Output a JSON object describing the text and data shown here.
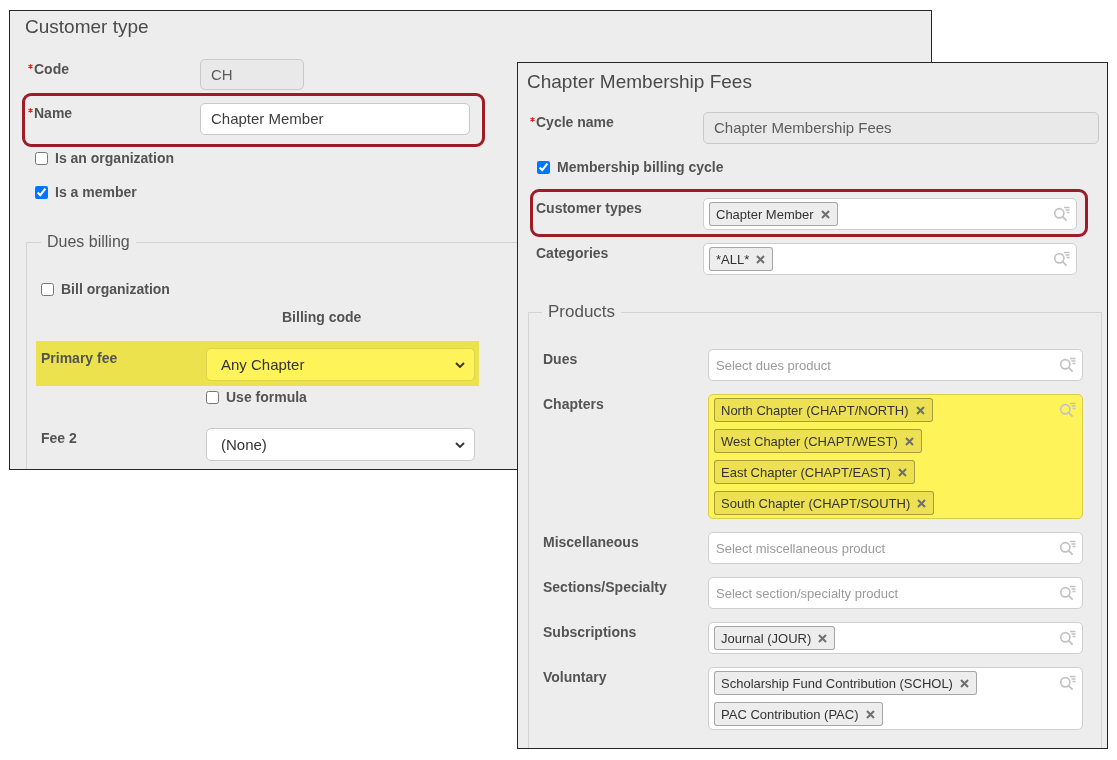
{
  "customer_type_window": {
    "title": "Customer type",
    "fields": [
      {
        "label": "Code",
        "required": true,
        "value": "CH",
        "disabled": true,
        "outlined": false
      },
      {
        "label": "Name",
        "required": true,
        "value": "Chapter Member",
        "disabled": false,
        "outlined": true
      }
    ],
    "checkboxes": [
      {
        "label": "Is an organization",
        "checked": false
      },
      {
        "label": "Is a member",
        "checked": true
      }
    ],
    "dues_billing": {
      "legend": "Dues billing",
      "bill_organization": {
        "label": "Bill organization",
        "checked": false
      },
      "column_heading": "Billing code",
      "fees": [
        {
          "label": "Primary fee",
          "value": "Any Chapter",
          "highlighted": true,
          "use_formula": {
            "label": "Use formula",
            "checked": false
          }
        },
        {
          "label": "Fee 2",
          "value": "(None)",
          "highlighted": false
        }
      ]
    }
  },
  "billing_cycle_window": {
    "title": "Chapter Membership Fees",
    "cycle_name": {
      "label": "Cycle name",
      "required": true,
      "value": "Chapter Membership Fees",
      "disabled": true
    },
    "membership_billing_cycle": {
      "label": "Membership billing cycle",
      "checked": true
    },
    "filters": [
      {
        "label": "Customer types",
        "tags": [
          "Chapter Member"
        ],
        "outlined": true
      },
      {
        "label": "Categories",
        "tags": [
          "*ALL*"
        ],
        "outlined": false
      }
    ],
    "products": {
      "legend": "Products",
      "pickers": [
        {
          "label": "Dues",
          "placeholder": "Select dues product",
          "highlighted": false
        },
        {
          "label": "Chapters",
          "tags": [
            "North Chapter (CHAPT/NORTH)",
            "West Chapter (CHAPT/WEST)",
            "East Chapter (CHAPT/EAST)",
            "South Chapter (CHAPT/SOUTH)"
          ],
          "highlighted": true
        },
        {
          "label": "Miscellaneous",
          "placeholder": "Select miscellaneous product",
          "highlighted": false
        },
        {
          "label": "Sections/Specialty",
          "placeholder": "Select section/specialty product",
          "highlighted": false
        },
        {
          "label": "Subscriptions",
          "tags": [
            "Journal (JOUR)"
          ],
          "highlighted": false
        },
        {
          "label": "Voluntary",
          "tags": [
            "Scholarship Fund Contribution (SCHOL)",
            "PAC Contribution (PAC)"
          ],
          "highlighted": false
        }
      ]
    }
  }
}
